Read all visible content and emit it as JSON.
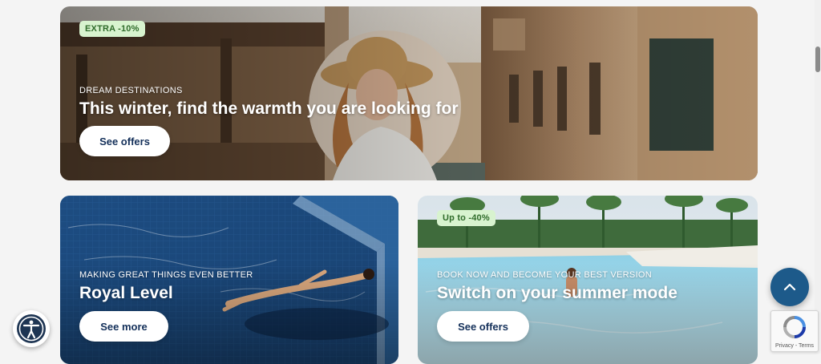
{
  "cards": {
    "winter": {
      "badge": "EXTRA -10%",
      "eyebrow": "DREAM DESTINATIONS",
      "title": "This winter, find the warmth you are looking for",
      "button": "See offers"
    },
    "royal": {
      "eyebrow": "MAKING GREAT THINGS EVEN BETTER",
      "title": "Royal Level",
      "button": "See more"
    },
    "summer": {
      "badge": "Up to -40%",
      "eyebrow": "BOOK NOW AND BECOME YOUR BEST VERSION",
      "title": "Switch on your summer mode",
      "button": "See offers"
    }
  },
  "widgets": {
    "scroll_top_icon": "chevron-up-icon",
    "accessibility_icon": "accessibility-icon",
    "recaptcha_terms": "Privacy - Terms"
  },
  "colors": {
    "button_text": "#14305a",
    "badge_bg": "#d8f3cf",
    "badge_text": "#2f6b2a",
    "scroll_top_bg": "#1d5a8a"
  }
}
